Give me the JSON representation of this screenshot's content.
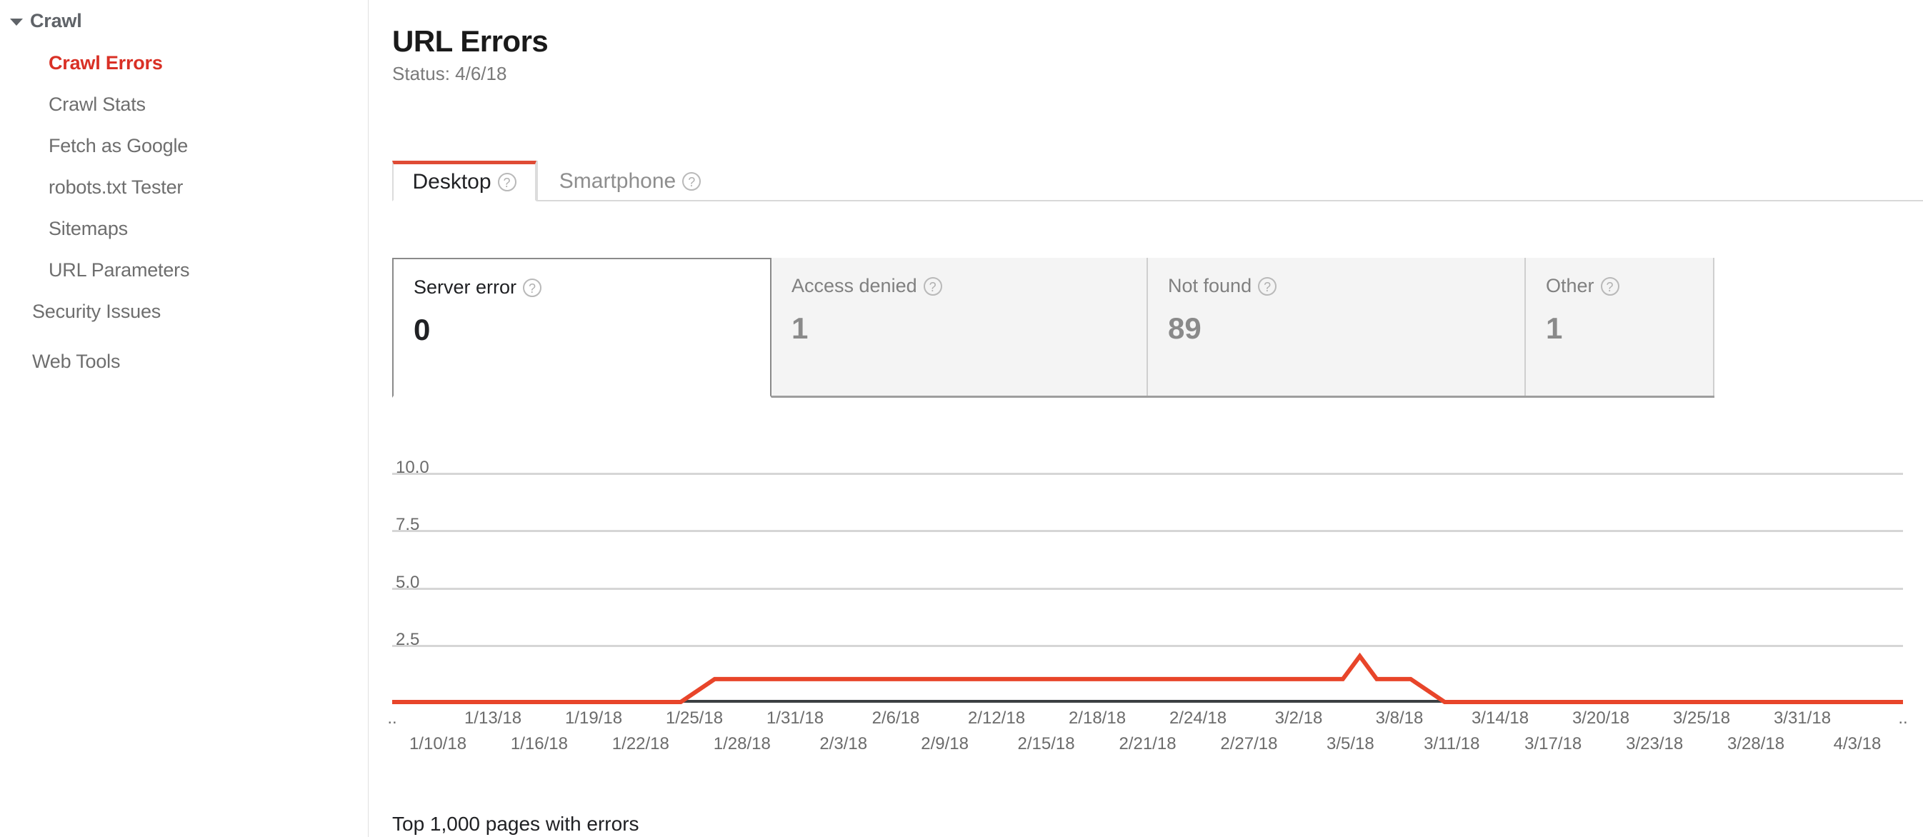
{
  "sidebar": {
    "group": {
      "label": "Crawl",
      "caret_icon": "caret-down-icon"
    },
    "items": [
      {
        "label": "Crawl Errors",
        "active": true,
        "level": "sub"
      },
      {
        "label": "Crawl Stats",
        "active": false,
        "level": "sub"
      },
      {
        "label": "Fetch as Google",
        "active": false,
        "level": "sub"
      },
      {
        "label": "robots.txt Tester",
        "active": false,
        "level": "sub"
      },
      {
        "label": "Sitemaps",
        "active": false,
        "level": "sub"
      },
      {
        "label": "URL Parameters",
        "active": false,
        "level": "sub"
      },
      {
        "label": "Security Issues",
        "active": false,
        "level": "top"
      },
      {
        "label": "Web Tools",
        "active": false,
        "level": "top"
      }
    ]
  },
  "header": {
    "title": "URL Errors",
    "status": "Status: 4/6/18"
  },
  "tabs": [
    {
      "label": "Desktop",
      "help_icon": "help-circle-icon",
      "active": true
    },
    {
      "label": "Smartphone",
      "help_icon": "help-circle-icon",
      "active": false
    }
  ],
  "cards": [
    {
      "label": "Server error",
      "value": "0",
      "help_icon": "help-circle-icon",
      "selected": true
    },
    {
      "label": "Access denied",
      "value": "1",
      "help_icon": "help-circle-icon",
      "selected": false
    },
    {
      "label": "Not found",
      "value": "89",
      "help_icon": "help-circle-icon",
      "selected": false
    },
    {
      "label": "Other",
      "value": "1",
      "help_icon": "help-circle-icon",
      "selected": false
    }
  ],
  "footer": {
    "note": "Top 1,000 pages with errors"
  },
  "colors": {
    "accent_red": "#df4b35",
    "series_red": "#e8452a",
    "active_nav": "#d93025",
    "card_bg": "#f4f4f4",
    "gridline": "#d6d6d6",
    "axis": "#3c4043"
  },
  "chart_data": {
    "type": "line",
    "title": "",
    "xlabel": "",
    "ylabel": "",
    "ylim": [
      0,
      11.0
    ],
    "grid": true,
    "legend": "none",
    "yticks": [
      "10.0",
      "7.5",
      "5.0",
      "2.5"
    ],
    "ytick_values": [
      10.0,
      7.5,
      5.0,
      2.5
    ],
    "xticks_top": [
      "..",
      "1/13/18",
      "1/19/18",
      "1/25/18",
      "1/31/18",
      "2/6/18",
      "2/12/18",
      "2/18/18",
      "2/24/18",
      "3/2/18",
      "3/8/18",
      "3/14/18",
      "3/20/18",
      "3/25/18",
      "3/31/18",
      ".."
    ],
    "xticks_bottom": [
      "1/10/18",
      "1/16/18",
      "1/22/18",
      "1/28/18",
      "2/3/18",
      "2/9/18",
      "2/15/18",
      "2/21/18",
      "2/27/18",
      "3/5/18",
      "3/11/18",
      "3/17/18",
      "3/23/18",
      "3/28/18",
      "4/3/18"
    ],
    "series": [
      {
        "name": "Server error",
        "color": "#e8452a",
        "x": [
          "1/7/18",
          "1/24/18",
          "1/26/18",
          "3/4/18",
          "3/5/18",
          "3/6/18",
          "3/8/18",
          "3/10/18",
          "4/6/18"
        ],
        "values": [
          0,
          0,
          1,
          1,
          2,
          1,
          1,
          0,
          0
        ]
      }
    ]
  }
}
